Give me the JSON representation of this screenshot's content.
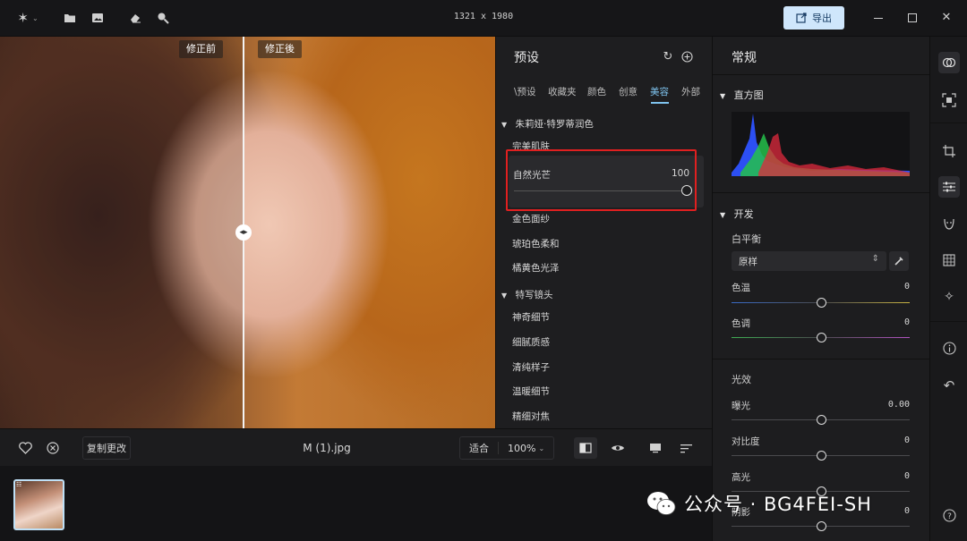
{
  "titlebar": {
    "dimensions": "1321 x 1980",
    "export_label": "导出"
  },
  "canvas": {
    "before_label": "修正前",
    "after_label": "修正後"
  },
  "bottombar": {
    "copy_changes": "复制更改",
    "filename": "M (1).jpg",
    "fit_label": "适合",
    "zoom": "100%"
  },
  "presets": {
    "title": "预设",
    "tabs": [
      "\\预设",
      "收藏夹",
      "颜色",
      "创意",
      "美容",
      "外部"
    ],
    "group1": {
      "title": "朱莉娅·特罗蒂润色",
      "items": [
        "完美肌肤",
        "自然光芒",
        "金色面纱",
        "琥珀色柔和",
        "橘黄色光泽"
      ],
      "active_value": "100"
    },
    "group2": {
      "title": "特写镜头",
      "items": [
        "神奇细节",
        "细腻质感",
        "清纯样子",
        "温暖细节",
        "精细对焦"
      ]
    }
  },
  "general": {
    "title": "常规",
    "histogram_label": "直方图",
    "develop_label": "开发",
    "white_balance": {
      "label": "白平衡",
      "selected": "原样",
      "temp_label": "色温",
      "temp_value": "0",
      "tint_label": "色调",
      "tint_value": "0"
    },
    "light": {
      "label": "光效",
      "exposure_label": "曝光",
      "exposure_value": "0.00",
      "contrast_label": "对比度",
      "contrast_value": "0",
      "highlights_label": "高光",
      "highlights_value": "0",
      "shadows_label": "阴影",
      "shadows_value": "0"
    }
  },
  "watermark": {
    "text": "公众号 · BG4FEI-SH"
  },
  "colors": {
    "accent": "#7fc3ee",
    "export_bg": "#cfe6fb",
    "highlight": "#e02020"
  }
}
